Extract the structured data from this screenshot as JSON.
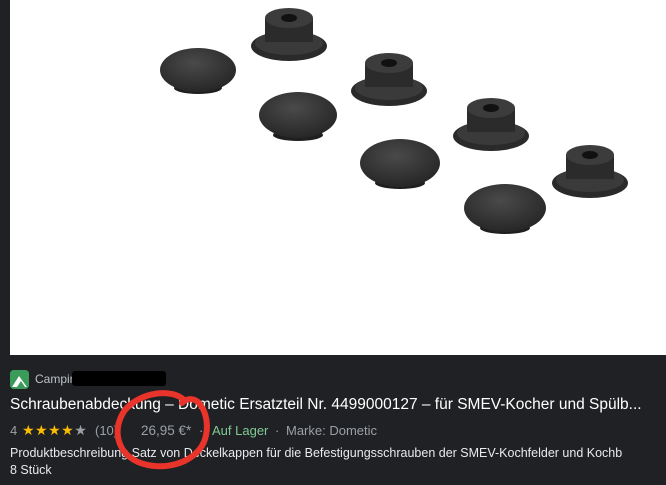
{
  "result": {
    "source": "Camping Wagner",
    "title": "Schraubenabdeckung – Dometic Ersatzteil Nr. 4499000127 – für SMEV-Kocher und Spülb...",
    "rating": "4",
    "stars": {
      "filled": "★★★★",
      "empty": "★"
    },
    "rating_count": "(10)",
    "price": "26,95 €*",
    "separator": "·",
    "stock": "Auf Lager",
    "brand": "Marke: Dometic",
    "description_line1": "Produktbeschreibung Satz von Deckelkappen für die Befestigungsschrauben der SMEV-Kochfelder und Kochb",
    "description_line2": "8 Stück"
  },
  "colors": {
    "page_bg": "#202124",
    "stars": "#fbbc04",
    "stock": "#81c995",
    "annotation": "#e8342a"
  }
}
